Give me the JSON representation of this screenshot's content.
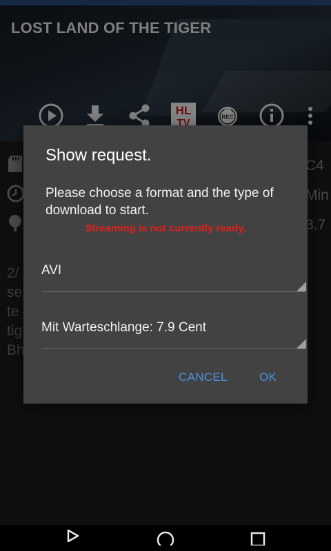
{
  "header": {
    "title": "LOST LAND OF THE TIGER"
  },
  "actions": {
    "play": "play-icon",
    "download": "download-icon",
    "share": "share-icon",
    "hltv_line1": "HL",
    "hltv_line2": "TV",
    "rec_label": "REC",
    "info": "info-icon",
    "more": "more-vert-icon"
  },
  "info_rows": [
    {
      "icon": "sd-card-icon",
      "value": "C4"
    },
    {
      "icon": "clock-icon",
      "value": "Min"
    },
    {
      "icon": "tree-icon",
      "value": "3.7"
    }
  ],
  "description_lines": [
    "2/",
    "se",
    "te",
    "tig",
    "Bh"
  ],
  "dialog": {
    "title": "Show request.",
    "message": "Please choose a format and the type of download to start.",
    "warning": "Streaming is not currently ready.",
    "format_value": "AVI",
    "download_type_value": "Mit Warteschlange: 7.9 Cent",
    "cancel_label": "CANCEL",
    "ok_label": "OK"
  },
  "colors": {
    "accent": "#4e8fe0",
    "warning": "#e0201a",
    "dialog_bg": "#424242"
  },
  "nav": {
    "back": "back-icon",
    "home": "home-icon",
    "recents": "recents-icon"
  }
}
